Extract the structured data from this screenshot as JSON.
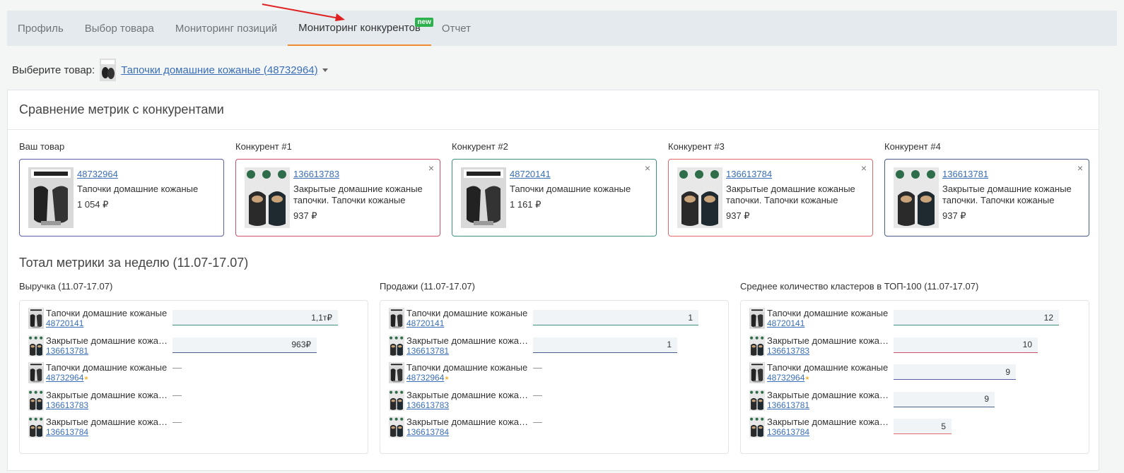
{
  "tabs": [
    {
      "label": "Профиль"
    },
    {
      "label": "Выбор товара"
    },
    {
      "label": "Мониторинг позиций"
    },
    {
      "label": "Мониторинг конкурентов",
      "badge": "new",
      "active": true
    },
    {
      "label": "Отчет"
    }
  ],
  "selector": {
    "label": "Выберите товар:",
    "value": "Тапочки домашние кожаные (48732964)"
  },
  "comparison": {
    "title": "Сравнение метрик с конкурентами",
    "cards": [
      {
        "label": "Ваш товар",
        "id": "48732964",
        "name": "Тапочки домашние кожаные",
        "price": "1 054 ₽",
        "border": "#5b5fa8",
        "closable": false
      },
      {
        "label": "Конкурент #1",
        "id": "136613783",
        "name": "Закрытые домашние кожаные тапочки. Тапочки кожаные",
        "price": "937 ₽",
        "border": "#c9526a",
        "closable": true
      },
      {
        "label": "Конкурент #2",
        "id": "48720141",
        "name": "Тапочки домашние кожаные",
        "price": "1 161 ₽",
        "border": "#3f8f7f",
        "closable": true
      },
      {
        "label": "Конкурент #3",
        "id": "136613784",
        "name": "Закрытые домашние кожаные тапочки. Тапочки кожаные",
        "price": "937 ₽",
        "border": "#e36a6a",
        "closable": true
      },
      {
        "label": "Конкурент #4",
        "id": "136613781",
        "name": "Закрытые домашние кожаные тапочки. Тапочки кожаные",
        "price": "937 ₽",
        "border": "#4a5f8a",
        "closable": true
      }
    ],
    "close_icon": "×"
  },
  "totals": {
    "title": "Тотал метрики за неделю (11.07-17.07)",
    "metrics": [
      {
        "title": "Выручка (11.07-17.07)",
        "rows": [
          {
            "name": "Тапочки домашние кожаные",
            "id": "48720141",
            "value": "1,1т₽",
            "fraction": 1.0,
            "color": "#3f8f7f",
            "star": false
          },
          {
            "name": "Закрытые домашние кожаные тапочки",
            "id": "136613781",
            "value": "963₽",
            "fraction": 0.87,
            "color": "#4a5f8a",
            "star": false
          },
          {
            "name": "Тапочки домашние кожаные",
            "id": "48732964",
            "value": "—",
            "fraction": 0,
            "color": "",
            "star": true
          },
          {
            "name": "Закрытые домашние кожаные тапочки",
            "id": "136613783",
            "value": "—",
            "fraction": 0,
            "color": "",
            "star": false
          },
          {
            "name": "Закрытые домашние кожаные тапочки",
            "id": "136613784",
            "value": "—",
            "fraction": 0,
            "color": "",
            "star": false
          }
        ]
      },
      {
        "title": "Продажи (11.07-17.07)",
        "rows": [
          {
            "name": "Тапочки домашние кожаные",
            "id": "48720141",
            "value": "1",
            "fraction": 1.0,
            "color": "#3f8f7f",
            "star": false
          },
          {
            "name": "Закрытые домашние кожаные тапочки",
            "id": "136613781",
            "value": "1",
            "fraction": 0.87,
            "color": "#4a5f8a",
            "star": false
          },
          {
            "name": "Тапочки домашние кожаные",
            "id": "48732964",
            "value": "—",
            "fraction": 0,
            "color": "",
            "star": true
          },
          {
            "name": "Закрытые домашние кожаные тапочки",
            "id": "136613783",
            "value": "—",
            "fraction": 0,
            "color": "",
            "star": false
          },
          {
            "name": "Закрытые домашние кожаные тапочки",
            "id": "136613784",
            "value": "—",
            "fraction": 0,
            "color": "",
            "star": false
          }
        ]
      },
      {
        "title": "Среднее количество кластеров в ТОП-100 (11.07-17.07)",
        "rows": [
          {
            "name": "Тапочки домашние кожаные",
            "id": "48720141",
            "value": "12",
            "fraction": 1.0,
            "color": "#3f8f7f",
            "star": false
          },
          {
            "name": "Закрытые домашние кожаные тапочки",
            "id": "136613783",
            "value": "10",
            "fraction": 0.87,
            "color": "#c9526a",
            "star": false
          },
          {
            "name": "Тапочки домашние кожаные",
            "id": "48732964",
            "value": "9",
            "fraction": 0.74,
            "color": "#5b5fa8",
            "star": true
          },
          {
            "name": "Закрытые домашние кожаные тапочки",
            "id": "136613781",
            "value": "9",
            "fraction": 0.61,
            "color": "#4a5f8a",
            "star": false
          },
          {
            "name": "Закрытые домашние кожаные тапочки",
            "id": "136613784",
            "value": "5",
            "fraction": 0.35,
            "color": "#e36a6a",
            "star": false
          }
        ]
      }
    ]
  }
}
